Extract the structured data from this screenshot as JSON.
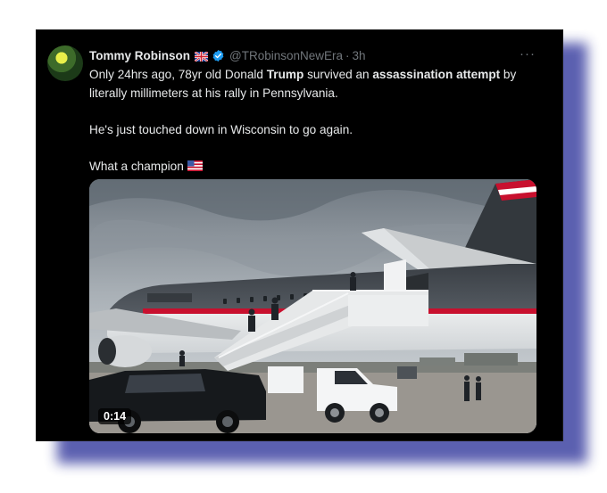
{
  "tweet": {
    "display_name": "Tommy Robinson",
    "flag_icon": "uk-flag-icon",
    "verified_icon": "verified-badge-icon",
    "handle": "@TRobinsonNewEra",
    "separator": "·",
    "time": "3h",
    "more_label": "···",
    "text": {
      "line1_a": "Only 24hrs ago, 78yr old Donald ",
      "line1_b": "Trump",
      "line1_c": " survived an ",
      "line1_d": "assassination attempt",
      "line2": " by literally millimeters at his rally in Pennsylvania.",
      "para2": "He's just touched down in Wisconsin to go again.",
      "para3": "What a champion"
    },
    "end_flag_icon": "us-flag-icon",
    "media": {
      "type": "video",
      "duration": "0:14"
    }
  },
  "colors": {
    "card_background": "#000000",
    "text": "#e7e9ea",
    "secondary_text": "#71767b",
    "verified": "#1d9bf0",
    "frame_shadow": "#4a4fa8"
  }
}
